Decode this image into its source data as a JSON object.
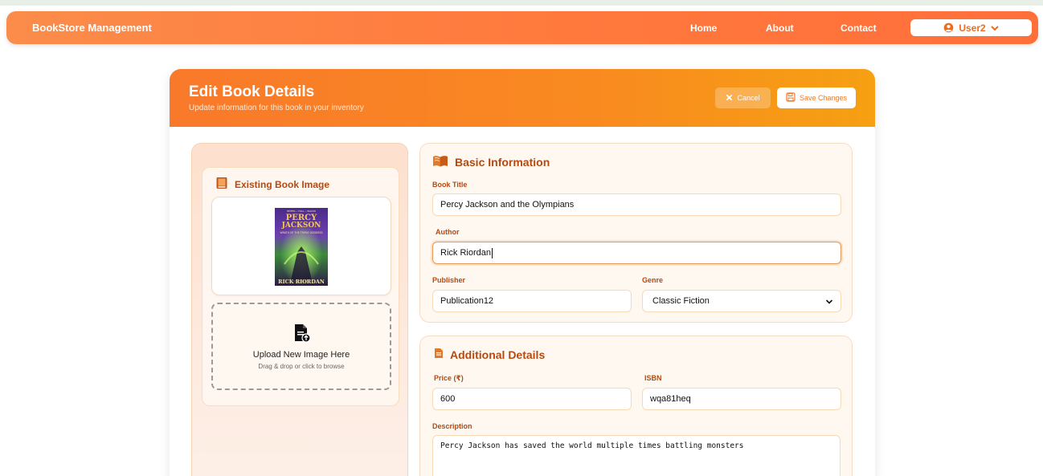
{
  "navbar": {
    "brand": "BookStore Management",
    "links": [
      "Home",
      "About",
      "Contact"
    ],
    "user": "User2"
  },
  "header": {
    "title": "Edit Book Details",
    "subtitle": "Update information for this book in your inventory",
    "cancel_label": "Cancel",
    "save_label": "Save Changes"
  },
  "image_panel": {
    "title": "Existing Book Image",
    "cover_text": {
      "top": "HEIFER • HALL • BLOOD",
      "line1": "PERCY",
      "line2": "JACKSON",
      "line3": "WRATH OF THE TRIPLE GODDESS",
      "author": "RICK RIORDAN"
    },
    "upload_title": "Upload New Image Here",
    "upload_sub": "Drag & drop or click to browse"
  },
  "basic_info": {
    "title": "Basic Information",
    "book_title_label": "Book Title",
    "book_title_value": "Percy Jackson and the Olympians",
    "author_label": "Author",
    "author_value": "Rick Riordan",
    "publisher_label": "Publisher",
    "publisher_value": "Publication12",
    "genre_label": "Genre",
    "genre_value": "Classic Fiction"
  },
  "additional": {
    "title": "Additional Details",
    "price_label": "Price (₹)",
    "price_value": "600",
    "isbn_label": "ISBN",
    "isbn_value": "wqa81heq",
    "description_label": "Description",
    "description_value": "Percy Jackson has saved the world multiple times battling monsters"
  },
  "colors": {
    "accent": "#f97a2b",
    "label": "#b34a12"
  }
}
